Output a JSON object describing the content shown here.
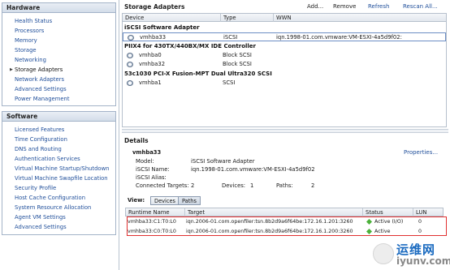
{
  "hardware": {
    "title": "Hardware",
    "items": [
      "Health Status",
      "Processors",
      "Memory",
      "Storage",
      "Networking",
      "Storage Adapters",
      "Network Adapters",
      "Advanced Settings",
      "Power Management"
    ]
  },
  "software": {
    "title": "Software",
    "items": [
      "Licensed Features",
      "Time Configuration",
      "DNS and Routing",
      "Authentication Services",
      "Virtual Machine Startup/Shutdown",
      "Virtual Machine Swapfile Location",
      "Security Profile",
      "Host Cache Configuration",
      "System Resource Allocation",
      "Agent VM Settings",
      "Advanced Settings"
    ]
  },
  "adapters": {
    "title": "Storage Adapters",
    "toolbar": {
      "add": "Add...",
      "remove": "Remove",
      "refresh": "Refresh",
      "rescan": "Rescan All..."
    },
    "columns": [
      "Device",
      "Type",
      "WWN"
    ],
    "groups": [
      {
        "name": "iSCSI Software Adapter",
        "rows": [
          {
            "device": "vmhba33",
            "type": "iSCSI",
            "wwn": "iqn.1998-01.com.vmware:VM-ESXI-4a5d9f02:"
          }
        ]
      },
      {
        "name": "PIIX4 for 430TX/440BX/MX IDE Controller",
        "rows": [
          {
            "device": "vmhba0",
            "type": "Block SCSI",
            "wwn": ""
          },
          {
            "device": "vmhba32",
            "type": "Block SCSI",
            "wwn": ""
          }
        ]
      },
      {
        "name": "53c1030 PCI-X Fusion-MPT Dual Ultra320 SCSI",
        "rows": [
          {
            "device": "vmhba1",
            "type": "SCSI",
            "wwn": ""
          }
        ]
      }
    ]
  },
  "details": {
    "title": "Details",
    "properties_link": "Properties...",
    "adapter": "vmhba33",
    "model_label": "Model:",
    "model": "iSCSI Software Adapter",
    "iscsi_name_label": "iSCSI Name:",
    "iscsi_name": "iqn.1998-01.com.vmware:VM-ESXI-4a5d9f02",
    "iscsi_alias_label": "iSCSI Alias:",
    "iscsi_alias": "",
    "targets_label": "Connected Targets:",
    "targets": "2",
    "devices_label": "Devices:",
    "devices": "1",
    "paths_label": "Paths:",
    "paths": "2",
    "view_label": "View:",
    "view_devices": "Devices",
    "view_paths": "Paths",
    "path_columns": [
      "Runtime Name",
      "Target",
      "Status",
      "LUN"
    ],
    "path_rows": [
      {
        "runtime": "vmhba33:C1:T0:L0",
        "target": "iqn.2006-01.com.openfiler:tsn.8b2d9a6f64be:172.16.1.201:3260",
        "status": "Active (I/O)",
        "lun": "0"
      },
      {
        "runtime": "vmhba33:C0:T0:L0",
        "target": "iqn.2006-01.com.openfiler:tsn.8b2d9a6f64be:172.16.1.200:3260",
        "status": "Active",
        "lun": "0"
      }
    ]
  },
  "watermark": {
    "line1": "运维网",
    "line2": "iyunv.com"
  },
  "colors": {
    "link": "#1f4e9a",
    "highlight": "#e03030",
    "active": "#4cb13a"
  }
}
